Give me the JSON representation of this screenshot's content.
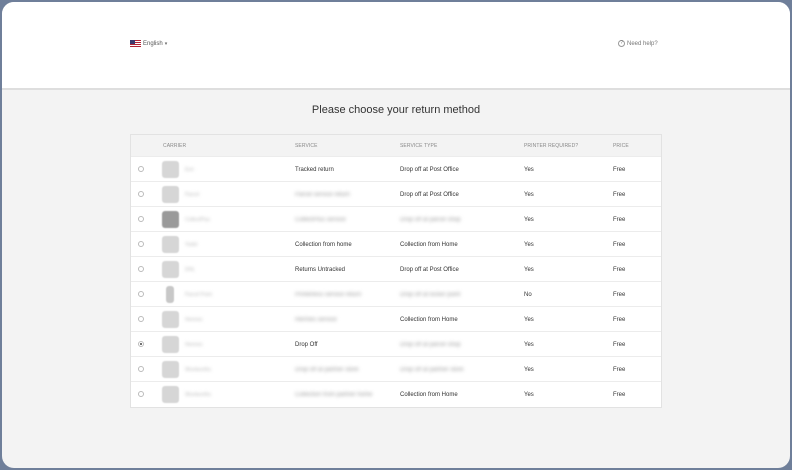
{
  "header": {
    "language": "English",
    "help": "Need help?"
  },
  "page": {
    "title": "Please choose your return method"
  },
  "table": {
    "columns": [
      "CARRIER",
      "SERVICE",
      "SERVICE TYPE",
      "PRINTER REQUIRED?",
      "PRICE"
    ],
    "rows": [
      {
        "carrier": "Evri",
        "service": "Tracked return",
        "type": "Drop off at Post Office",
        "printer": "Yes",
        "price": "Free",
        "selected": false
      },
      {
        "carrier": "Parcel",
        "service": "Parcel service return",
        "type": "Drop off at Post Office",
        "printer": "Yes",
        "price": "Free",
        "selected": false
      },
      {
        "carrier": "CollectPlus",
        "service": "CollectPlus service",
        "type": "Drop off at parcel shop",
        "printer": "Yes",
        "price": "Free",
        "selected": false
      },
      {
        "carrier": "Yodel",
        "service": "Collection from home",
        "type": "Collection from Home",
        "printer": "Yes",
        "price": "Free",
        "selected": false
      },
      {
        "carrier": "DHL",
        "service": "Returns Untracked",
        "type": "Drop off at Post Office",
        "printer": "Yes",
        "price": "Free",
        "selected": false
      },
      {
        "carrier": "Parcel Point",
        "service": "Printerless service return",
        "type": "Drop off at locker point",
        "printer": "No",
        "price": "Free",
        "selected": false
      },
      {
        "carrier": "Hermes",
        "service": "Hermes service",
        "type": "Collection from Home",
        "printer": "Yes",
        "price": "Free",
        "selected": false
      },
      {
        "carrier": "Hermes",
        "service": "Drop Off",
        "type": "Drop off at parcel shop",
        "printer": "Yes",
        "price": "Free",
        "selected": true
      },
      {
        "carrier": "Woolworths",
        "service": "Drop off at partner store",
        "type": "Drop off at partner store",
        "printer": "Yes",
        "price": "Free",
        "selected": false
      },
      {
        "carrier": "Woolworths",
        "service": "Collection from partner home",
        "type": "Collection from Home",
        "printer": "Yes",
        "price": "Free",
        "selected": false
      }
    ]
  }
}
